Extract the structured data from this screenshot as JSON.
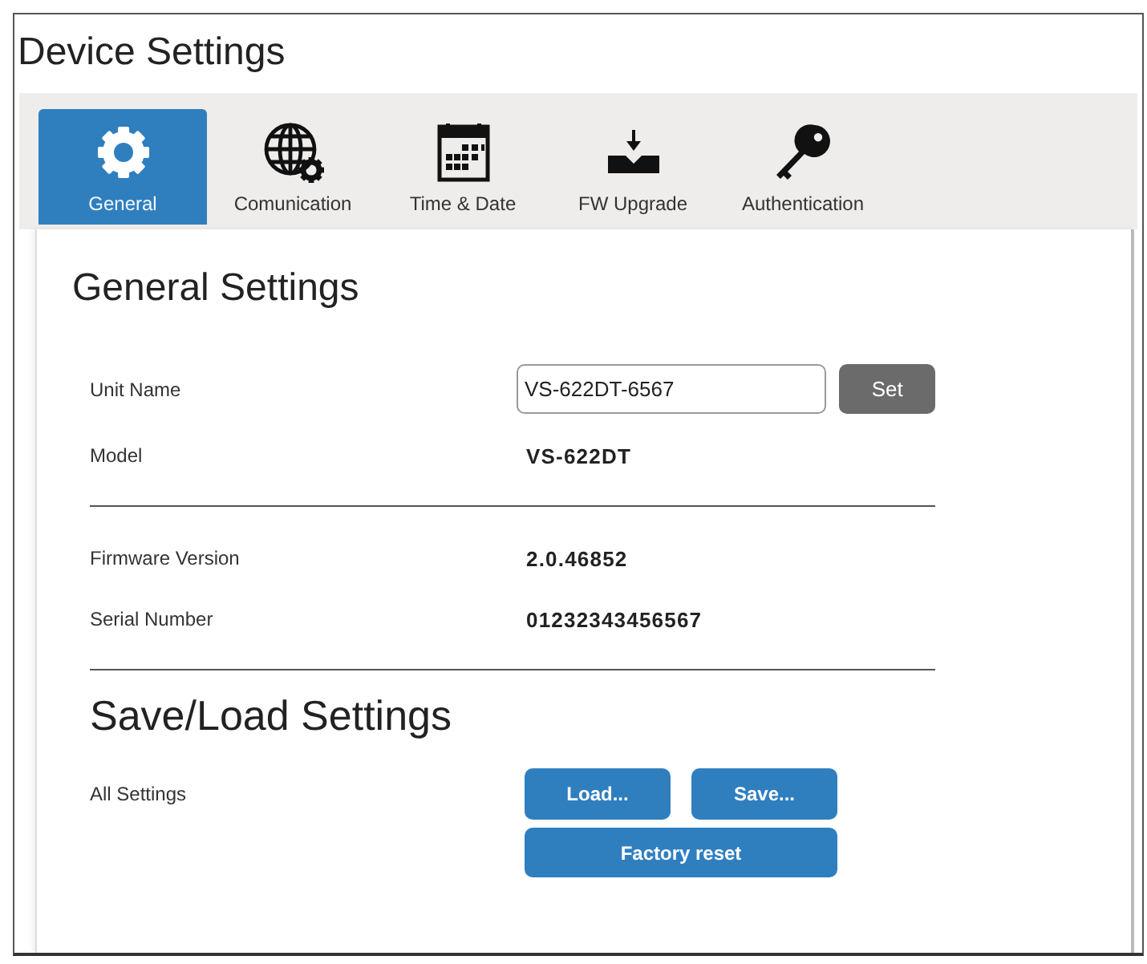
{
  "window": {
    "title": "Device Settings"
  },
  "tabs": [
    {
      "label": "General",
      "selected": true
    },
    {
      "label": "Comunication",
      "selected": false
    },
    {
      "label": "Time & Date",
      "selected": false
    },
    {
      "label": "FW Upgrade",
      "selected": false
    },
    {
      "label": "Authentication",
      "selected": false
    }
  ],
  "general_settings": {
    "heading": "General Settings",
    "groups": [
      [
        {
          "kind": "input",
          "label": "Unit Name",
          "value": "VS-622DT-6567",
          "button": "Set"
        },
        {
          "kind": "info",
          "label": "Model",
          "value": "VS-622DT"
        }
      ],
      [
        {
          "kind": "info",
          "label": "Firmware Version",
          "value": "2.0.46852"
        },
        {
          "kind": "info",
          "label": "Serial Number",
          "value": "01232343456567"
        }
      ]
    ]
  },
  "save_load_settings": {
    "heading": "Save/Load Settings",
    "label": "All Settings",
    "buttons": [
      "Load...",
      "Save...",
      "Factory reset"
    ]
  }
}
